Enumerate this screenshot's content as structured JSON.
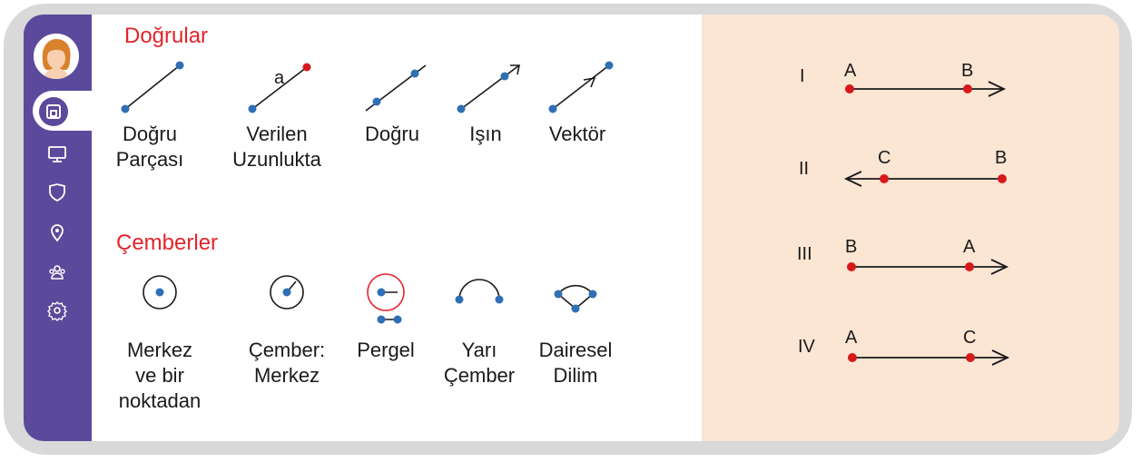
{
  "sidebar": {
    "nav_items": [
      "home",
      "screen",
      "shield",
      "location",
      "users",
      "settings"
    ],
    "active_item": "home"
  },
  "sections": {
    "lines_title": "Doğrular",
    "circles_title": "Çemberler"
  },
  "line_tools": [
    {
      "label": "Doğru\nParçası",
      "icon": "segment-icon"
    },
    {
      "label": "Verilen\nUzunlukta",
      "icon": "segment-with-length-icon",
      "marker": "a"
    },
    {
      "label": "Doğru",
      "icon": "line-icon"
    },
    {
      "label": "Işın",
      "icon": "ray-icon"
    },
    {
      "label": "Vektör",
      "icon": "vector-icon"
    }
  ],
  "circle_tools": [
    {
      "label": "Merkez\nve bir\nnoktadan",
      "icon": "circle-center-point-icon"
    },
    {
      "label": "Çember:\nMerkez",
      "icon": "circle-center-radius-icon"
    },
    {
      "label": "Pergel",
      "icon": "compass-icon"
    },
    {
      "label": "Yarı\nÇember",
      "icon": "semicircle-icon"
    },
    {
      "label": "Dairesel\nDilim",
      "icon": "circular-sector-icon"
    }
  ],
  "options": [
    {
      "roman": "I",
      "left_point": "A",
      "right_point": "B",
      "arrow": "right"
    },
    {
      "roman": "II",
      "left_point": "C",
      "right_point": "B",
      "arrow": "left"
    },
    {
      "roman": "III",
      "left_point": "B",
      "right_point": "A",
      "arrow": "right"
    },
    {
      "roman": "IV",
      "left_point": "A",
      "right_point": "C",
      "arrow": "right"
    }
  ],
  "colors": {
    "sidebar": "#5b4a9b",
    "accent_red": "#e3242b",
    "point_blue": "#2f6fb5",
    "point_red": "#d7191c",
    "right_panel": "#fbe5d3",
    "frame": "#d9d9d9"
  }
}
